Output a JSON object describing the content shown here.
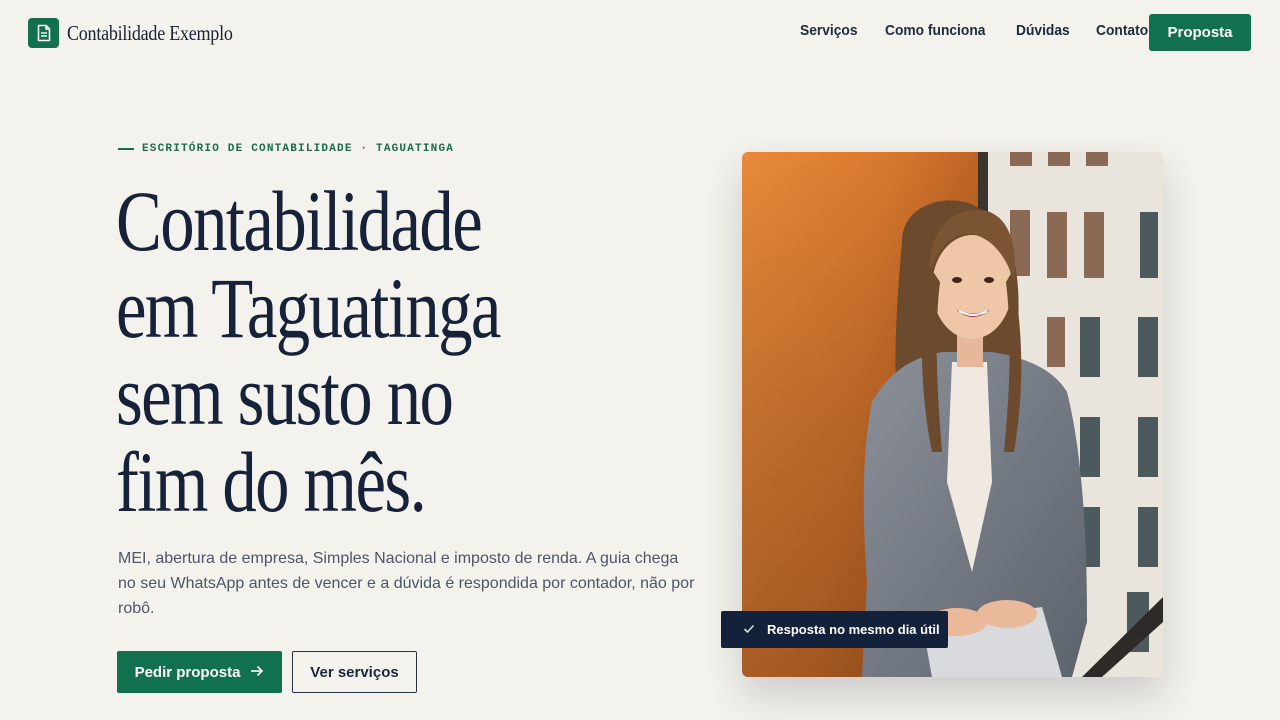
{
  "brand": {
    "name": "Contabilidade Exemplo",
    "icon": "document-icon"
  },
  "nav": {
    "items": [
      {
        "label": "Serviços"
      },
      {
        "label": "Como funciona"
      },
      {
        "label": "Dúvidas"
      },
      {
        "label": "Contato"
      }
    ],
    "cta_label": "Proposta"
  },
  "hero": {
    "eyebrow": "ESCRITÓRIO DE CONTABILIDADE · TAGUATINGA",
    "headline_lines": [
      "Contabilidade",
      "em Taguatinga",
      "sem susto no",
      "fim do mês."
    ],
    "lead": "MEI, abertura de empresa, Simples Nacional e imposto de renda. A guia chega no seu WhatsApp antes de vencer e a dúvida é respondida por contador, não por robô.",
    "primary_button": "Pedir proposta",
    "primary_icon": "arrow-right-icon",
    "secondary_button": "Ver serviços"
  },
  "photo": {
    "badge_label": "Resposta no mesmo dia útil",
    "badge_icon": "check-icon"
  },
  "colors": {
    "background": "#f4f2ec",
    "accent": "#11704d",
    "text": "#16213a",
    "badge": "#13213a"
  }
}
